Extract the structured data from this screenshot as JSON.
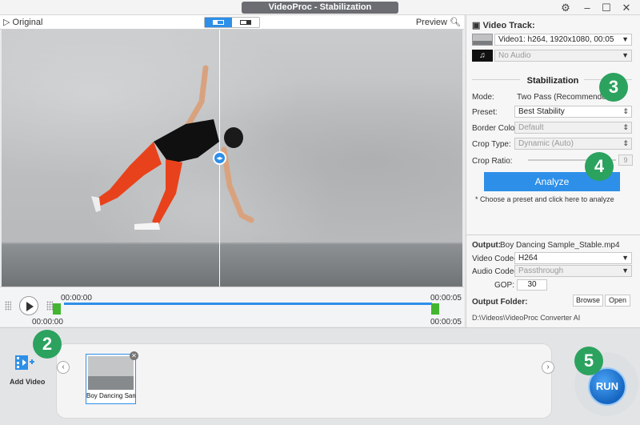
{
  "window": {
    "title": "VideoProc - Stabilization",
    "settings_icon": "gear-icon",
    "minimize_icon": "minimize-icon",
    "maximize_icon": "maximize-icon",
    "close_icon": "close-icon"
  },
  "viewer": {
    "original_label": "Original",
    "preview_label": "Preview",
    "split_modes": [
      "split-view",
      "side-by-side"
    ]
  },
  "timeline": {
    "current_time": "00:00:00",
    "start_time": "00:00:00",
    "end_time": "00:00:05",
    "end_time_bottom": "00:00:05",
    "start_time_bottom": "00:00:00"
  },
  "sidebar": {
    "video_track_label": "Video Track:",
    "video_track_value": "Video1: h264, 1920x1080, 00:05",
    "audio_track_value": "No Audio",
    "stabilization_title": "Stabilization",
    "mode_label": "Mode:",
    "mode_value": "Two Pass (Recommended)",
    "preset_label": "Preset:",
    "preset_value": "Best Stability",
    "border_color_label": "Border Color:",
    "border_color_value": "Default",
    "crop_type_label": "Crop Type:",
    "crop_type_value": "Dynamic (Auto)",
    "crop_ratio_label": "Crop Ratio:",
    "crop_ratio_value": "9",
    "analyze_label": "Analyze",
    "hint": "* Choose a preset and click here to analyze",
    "output_label": "Output:",
    "output_value": "Boy Dancing Sample_Stable.mp4",
    "video_codec_label": "Video Codec:",
    "video_codec_value": "H264",
    "audio_codec_label": "Audio Codec:",
    "audio_codec_value": "Passthrough",
    "gop_label": "GOP:",
    "gop_value": "30",
    "output_folder_label": "Output Folder:",
    "browse_label": "Browse",
    "open_label": "Open",
    "folder_path": "D:\\Videos\\VideoProc Converter AI"
  },
  "bottom": {
    "add_video_label": "Add Video",
    "clip_label": "Boy Dancing Sam",
    "run_label": "RUN"
  },
  "badges": [
    "2",
    "3",
    "4",
    "5"
  ],
  "colors": {
    "accent": "#2d8fe8",
    "badge": "#2ca25f",
    "marker": "#43b531"
  }
}
